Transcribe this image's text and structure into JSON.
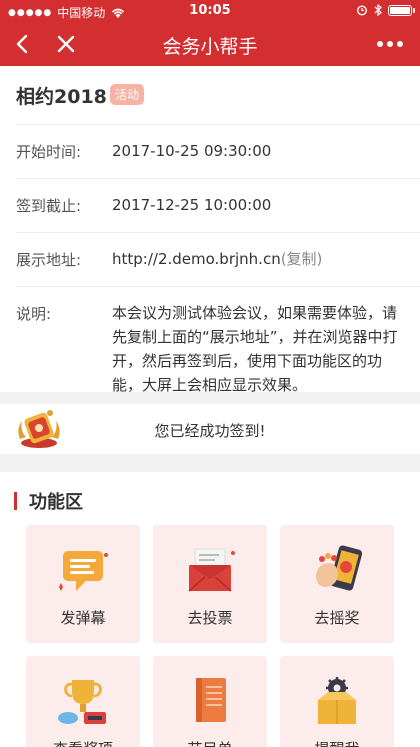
{
  "status_bar": {
    "carrier": "中国移动",
    "time": "10:05"
  },
  "nav": {
    "title": "会务小帮手"
  },
  "event": {
    "title": "相约2018",
    "badge": "活动",
    "rows": [
      {
        "label": "开始时间:",
        "value": "2017-10-25 09:30:00"
      },
      {
        "label": "签到截止:",
        "value": "2017-12-25 10:00:00"
      },
      {
        "label": "展示地址:",
        "value": "http://2.demo.brjnh.cn",
        "extra": "(复制)"
      },
      {
        "label": "说明:",
        "value": "本会议为测试体验会议，如果需要体验，请先复制上面的“展示地址”，并在浏览器中打开，然后再签到后，使用下面功能区的功能，大屏上会相应显示效果。"
      }
    ]
  },
  "checkin": {
    "message": "您已经成功签到!"
  },
  "functions": {
    "title": "功能区",
    "tiles": [
      {
        "label": "发弹幕",
        "icon": "danmaku-bubble-icon"
      },
      {
        "label": "去投票",
        "icon": "vote-envelope-icon"
      },
      {
        "label": "去摇奖",
        "icon": "lottery-phone-icon"
      },
      {
        "label": "查看奖项",
        "icon": "prizes-trophy-icon"
      },
      {
        "label": "节目单",
        "icon": "program-book-icon"
      },
      {
        "label": "提醒我",
        "icon": "reminder-box-icon"
      }
    ]
  },
  "colors": {
    "brand": "#d42f30",
    "badge": "#f6b2a3",
    "tile_bg": "#fdecec"
  }
}
